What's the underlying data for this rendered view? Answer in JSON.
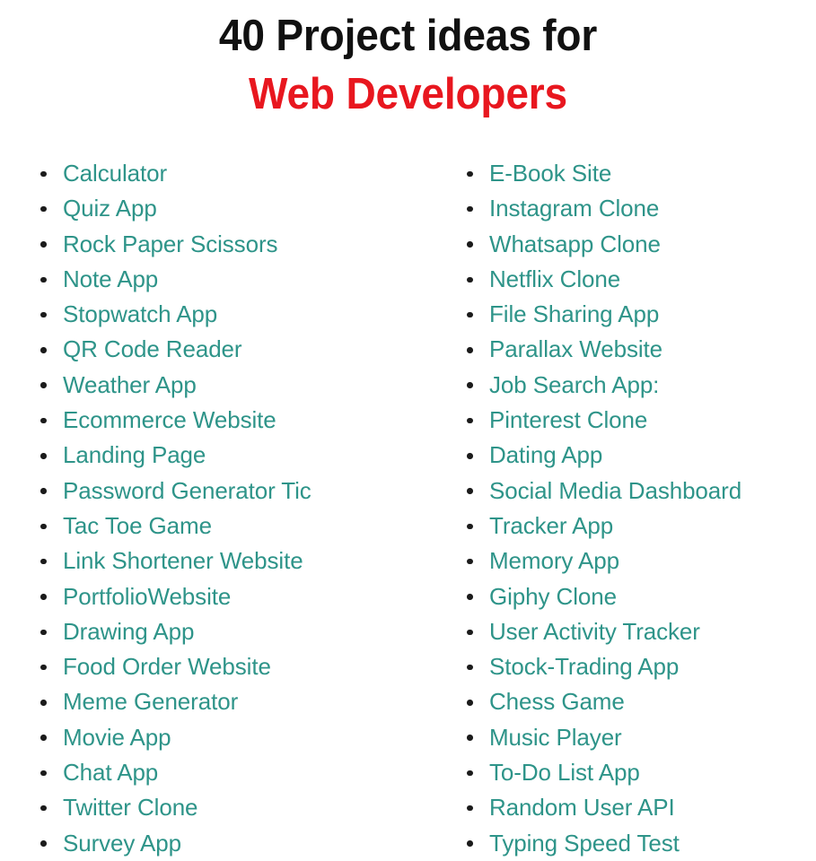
{
  "poster": {
    "title_line_1": "40 Project ideas for",
    "title_line_2": "Web Developers",
    "title_color_primary": "#111111",
    "title_color_accent": "#e8171f",
    "list_color": "#2e9489",
    "bullet_color": "#1b1b1b",
    "background_color": "#ffffff",
    "total_count": 40,
    "bullet_icon": "bullet-dot-icon"
  },
  "columns": {
    "left": [
      "Calculator",
      "Quiz App",
      "Rock Paper Scissors",
      "Note App",
      "Stopwatch App",
      "QR Code Reader",
      "Weather App",
      "Ecommerce Website",
      "Landing Page",
      "Password Generator Tic",
      "Tac Toe Game",
      "Link Shortener Website",
      "PortfolioWebsite",
      "Drawing App",
      "Food Order Website",
      "Meme Generator",
      "Movie App",
      "Chat App",
      "Twitter Clone",
      "Survey App"
    ],
    "right": [
      "E-Book Site",
      "Instagram Clone",
      "Whatsapp Clone",
      "Netflix Clone",
      "File Sharing App",
      "Parallax Website",
      "Job Search App:",
      "Pinterest Clone",
      "Dating App",
      "Social Media Dashboard",
      "Tracker App",
      "Memory App",
      "Giphy Clone",
      "User Activity Tracker",
      "Stock-Trading App",
      "Chess Game",
      "Music Player",
      "To-Do List App",
      "Random User API",
      "Typing Speed Test"
    ]
  }
}
